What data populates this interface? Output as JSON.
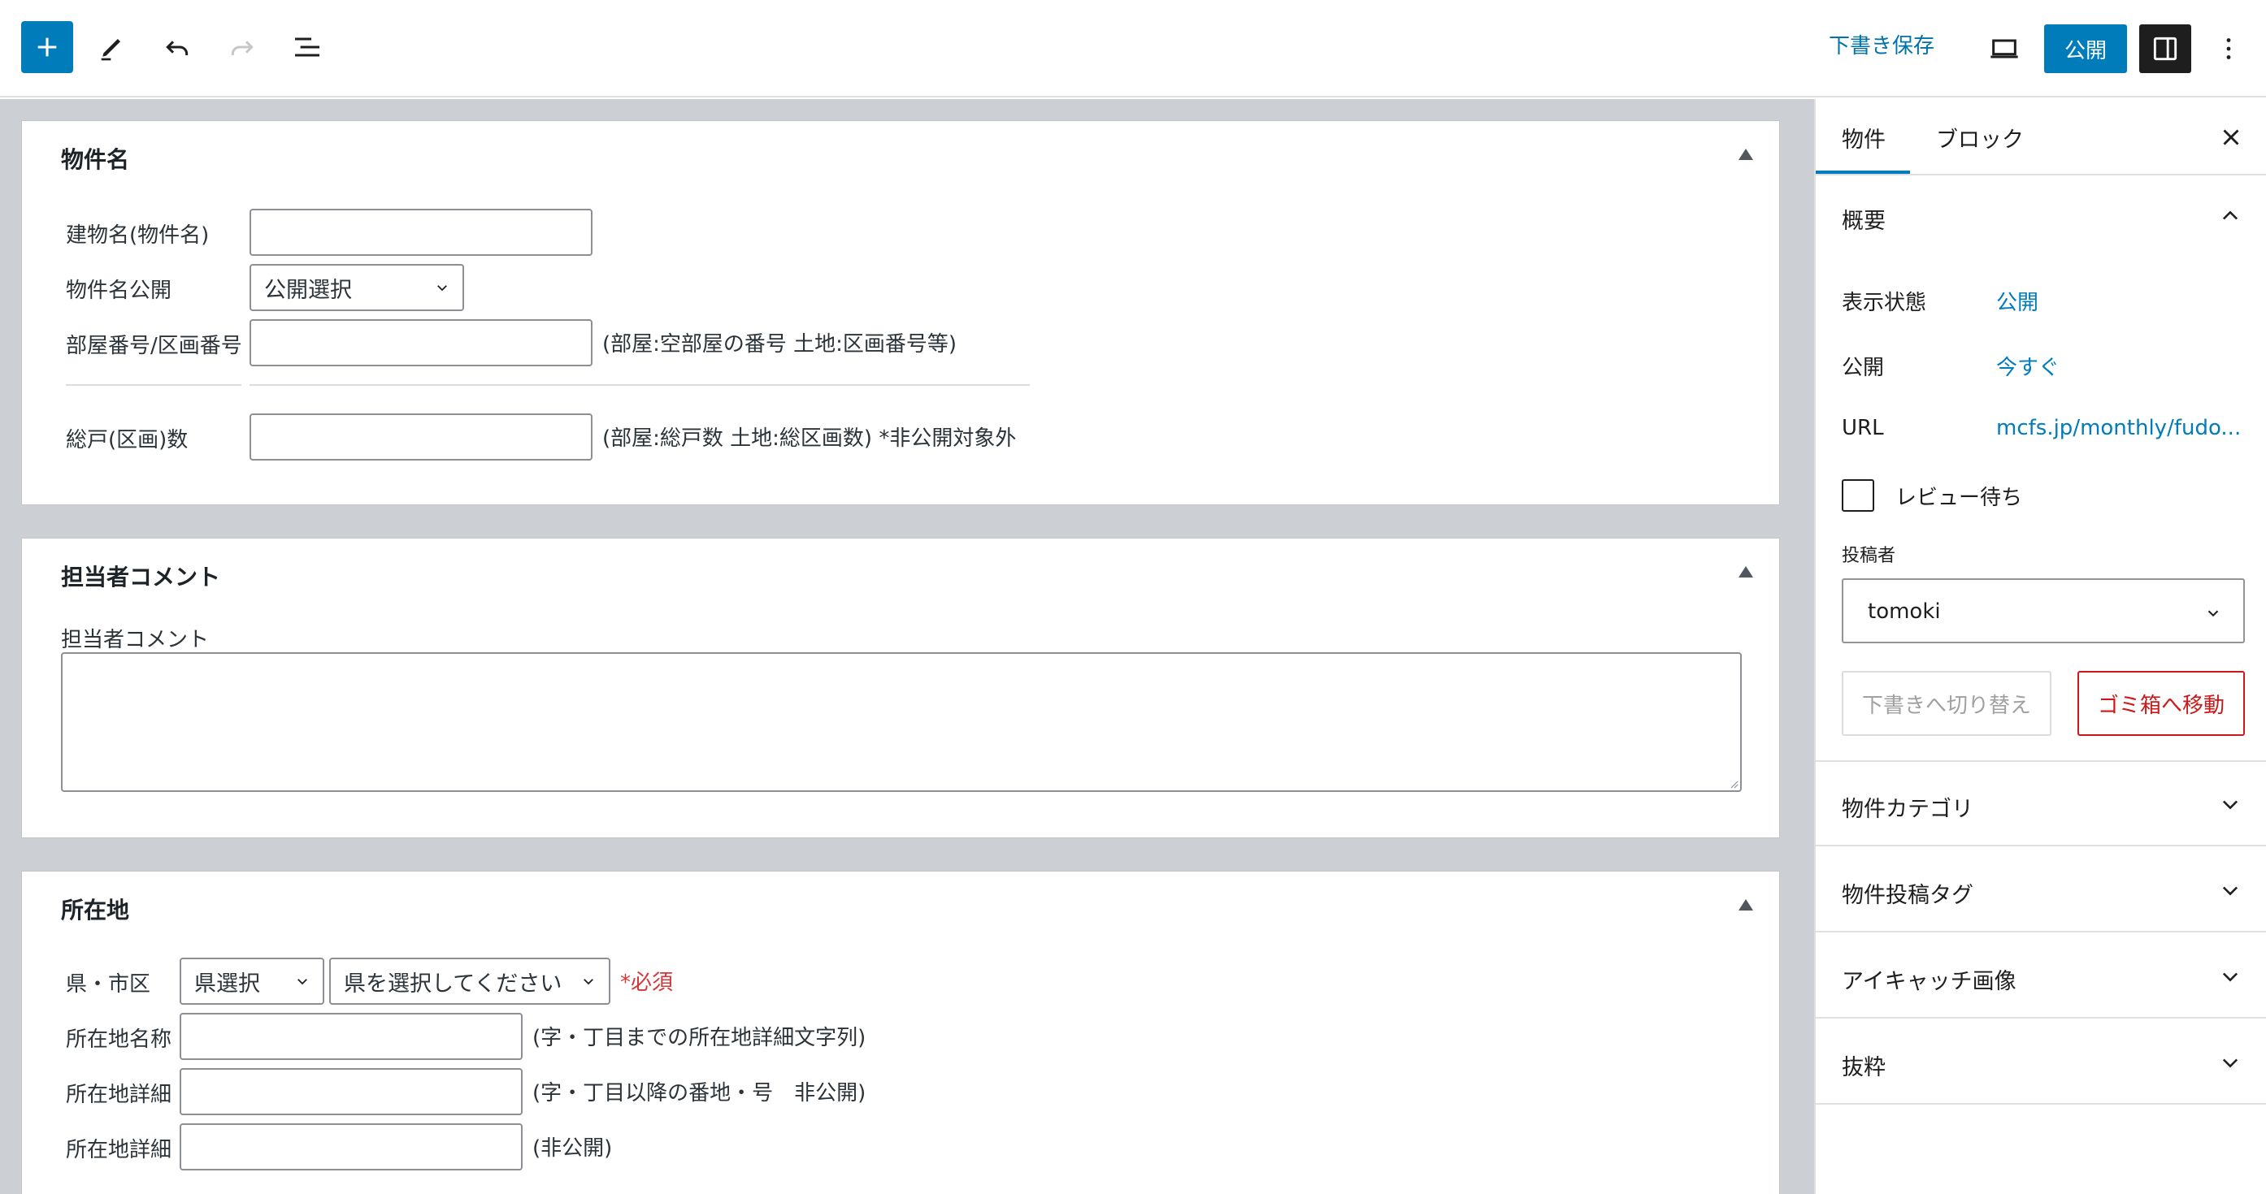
{
  "toolbar": {
    "add_icon": "plus-icon",
    "tools_icon": "pencil-icon",
    "undo_icon": "undo-icon",
    "redo_icon": "redo-icon",
    "list_view_icon": "list-view-icon",
    "save_draft_label": "下書き保存",
    "preview_icon": "laptop-icon",
    "publish_label": "公開",
    "settings_icon": "sidebar-icon",
    "more_icon": "more-vertical-icon"
  },
  "panels": {
    "property_name": {
      "title": "物件名",
      "building_name_label": "建物名(物件名)",
      "building_name_value": "",
      "name_publish_label": "物件名公開",
      "name_publish_selected": "公開選択",
      "room_number_label": "部屋番号/区画番号",
      "room_number_value": "",
      "room_number_hint": "(部屋:空部屋の番号 土地:区画番号等)",
      "total_units_label": "総戸(区画)数",
      "total_units_value": "",
      "total_units_hint": "(部屋:総戸数 土地:総区画数) *非公開対象外"
    },
    "staff_comment": {
      "title": "担当者コメント",
      "field_label": "担当者コメント",
      "value": ""
    },
    "location": {
      "title": "所在地",
      "pref_city_label": "県・市区",
      "pref_select": "県選択",
      "city_select": "県を選択してください",
      "required_mark": "*必須",
      "address_name_label": "所在地名称",
      "address_name_hint": "(字・丁目までの所在地詳細文字列)",
      "address_detail_label": "所在地詳細",
      "address_detail_hint": "(字・丁目以降の番地・号　非公開)",
      "address_detail2_label": "所在地詳細",
      "address_detail2_hint": "(非公開)"
    }
  },
  "sidebar": {
    "tabs": [
      "物件",
      "ブロック"
    ],
    "close_icon": "close-icon",
    "summary": {
      "title": "概要",
      "visibility_label": "表示状態",
      "visibility_value": "公開",
      "publish_label": "公開",
      "publish_value": "今すぐ",
      "url_label": "URL",
      "url_value": "mcfs.jp/monthly/fudo...",
      "review_label": "レビュー待ち",
      "review_checked": false,
      "author_label": "投稿者",
      "author_value": "tomoki",
      "switch_draft_label": "下書きへ切り替え",
      "trash_label": "ゴミ箱へ移動"
    },
    "sections": [
      "物件カテゴリ",
      "物件投稿タグ",
      "アイキャッチ画像",
      "抜粋"
    ]
  },
  "colors": {
    "accent": "#007cba",
    "danger": "#cc1818",
    "canvas_bg": "#ccd0d4"
  }
}
